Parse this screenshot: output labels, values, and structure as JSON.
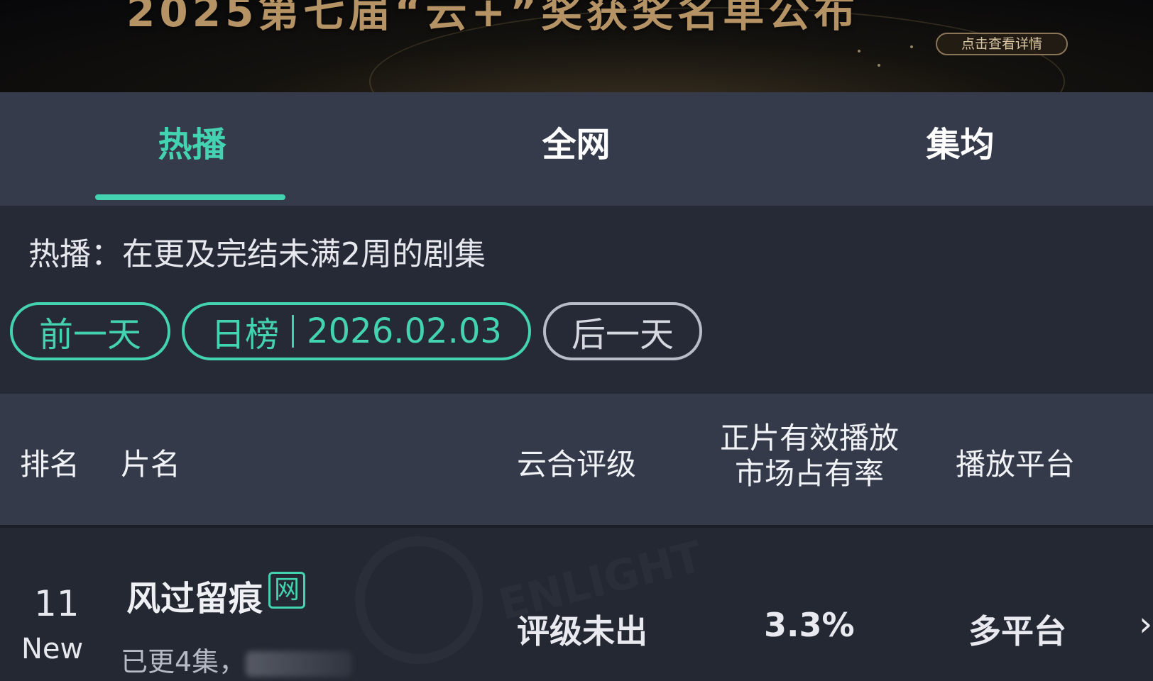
{
  "banner": {
    "title": "2025第七届“云+”奖获奖名单公布",
    "details_button": "点击查看详情"
  },
  "tabs": [
    {
      "label": "热播",
      "active": true
    },
    {
      "label": "全网",
      "active": false
    },
    {
      "label": "集均",
      "active": false
    }
  ],
  "filter": {
    "description": "热播：在更及完结未满2周的剧集",
    "prev_day": "前一天",
    "date_label": "日榜",
    "date": "2026.02.03",
    "next_day": "后一天"
  },
  "table": {
    "headers": {
      "rank": "排名",
      "title": "片名",
      "rating": "云合评级",
      "share_line1": "正片有效播放",
      "share_line2": "市场占有率",
      "platform": "播放平台"
    },
    "rows": [
      {
        "rank": "11",
        "badge": "New",
        "title": "风过留痕",
        "tag": "网",
        "subtitle": "已更4集，",
        "rating": "评级未出",
        "share": "3.3%",
        "platform": "多平台"
      }
    ]
  },
  "icons": {
    "row_chevron": "chevron-right-icon"
  },
  "colors": {
    "accent": "#43d3b0",
    "header_bg": "#353b4b",
    "filter_bg": "#262a36"
  }
}
